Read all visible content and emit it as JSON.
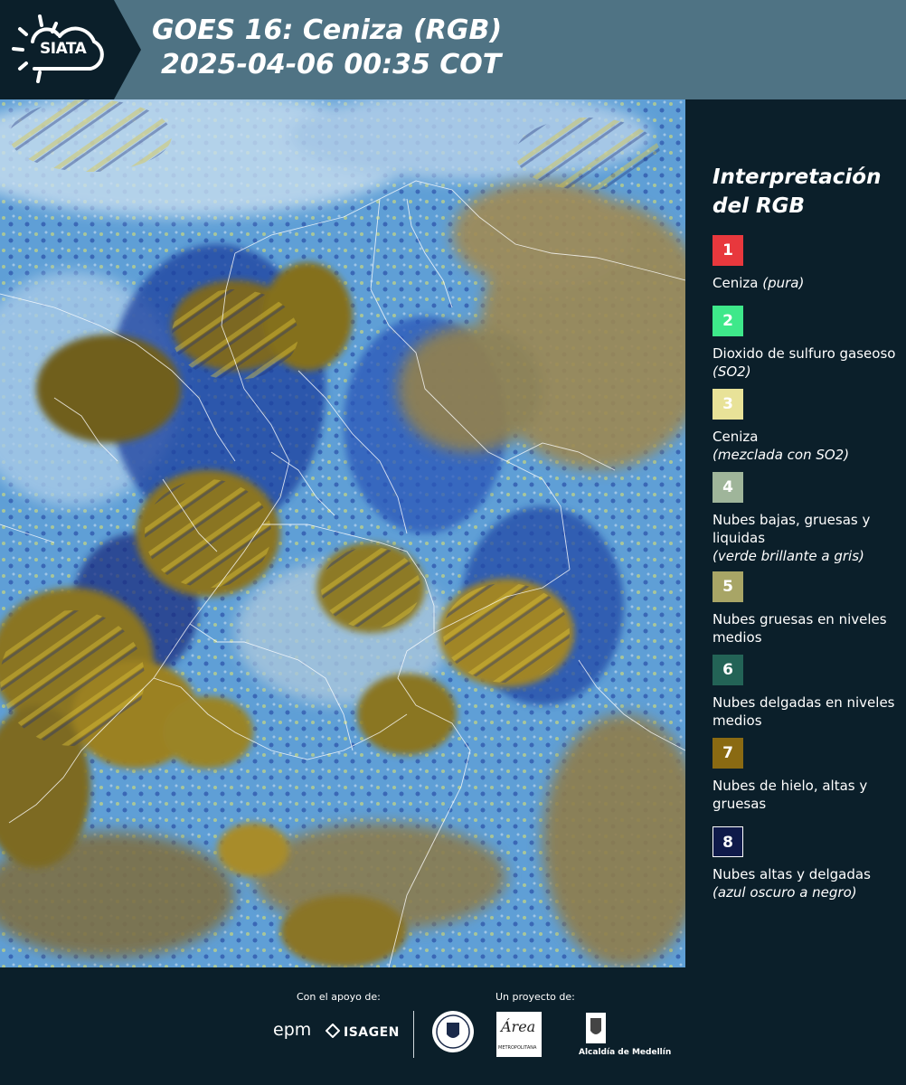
{
  "header": {
    "logo_text": "SIATA",
    "title_line1": "GOES 16: Ceniza (RGB)",
    "title_line2": "2025-04-06 00:35 COT"
  },
  "map": {
    "description_colors": {
      "ocean": "#6fa8d6",
      "thick_cloud": "#8a7a3a",
      "high_ice": "#c9a820",
      "thin_high": "#1b2a6b",
      "border_lines": "#ffffff"
    }
  },
  "legend": {
    "title_line1": "Interpretación",
    "title_line2": "del RGB",
    "items": [
      {
        "num": "1",
        "color": "#e8383d",
        "text": "Ceniza",
        "note": "(pura)"
      },
      {
        "num": "2",
        "color": "#3ee88a",
        "text": "Dioxido de sulfuro gaseoso",
        "note": "(SO2)"
      },
      {
        "num": "3",
        "color": "#e8e298",
        "text": "Ceniza",
        "note": "(mezclada con SO2)"
      },
      {
        "num": "4",
        "color": "#9fb59a",
        "text": "Nubes bajas, gruesas y liquidas",
        "note": "(verde brillante a gris)"
      },
      {
        "num": "5",
        "color": "#a8a566",
        "text": "Nubes gruesas en niveles medios",
        "note": ""
      },
      {
        "num": "6",
        "color": "#236356",
        "text": "Nubes delgadas en niveles medios",
        "note": ""
      },
      {
        "num": "7",
        "color": "#8a6a12",
        "text": "Nubes de hielo, altas y gruesas",
        "note": ""
      },
      {
        "num": "8",
        "color": "#0f1a4a",
        "text": "Nubes altas y delgadas",
        "note": "(azul oscuro a negro)"
      }
    ]
  },
  "footer": {
    "support_label": "Con el apoyo de:",
    "project_label": "Un proyecto de:",
    "epm": "epm",
    "isagen": "ISAGEN",
    "area_name": "Área",
    "area_sub": "METROPOLITANA",
    "alcaldia": "Alcaldía de Medellín"
  }
}
